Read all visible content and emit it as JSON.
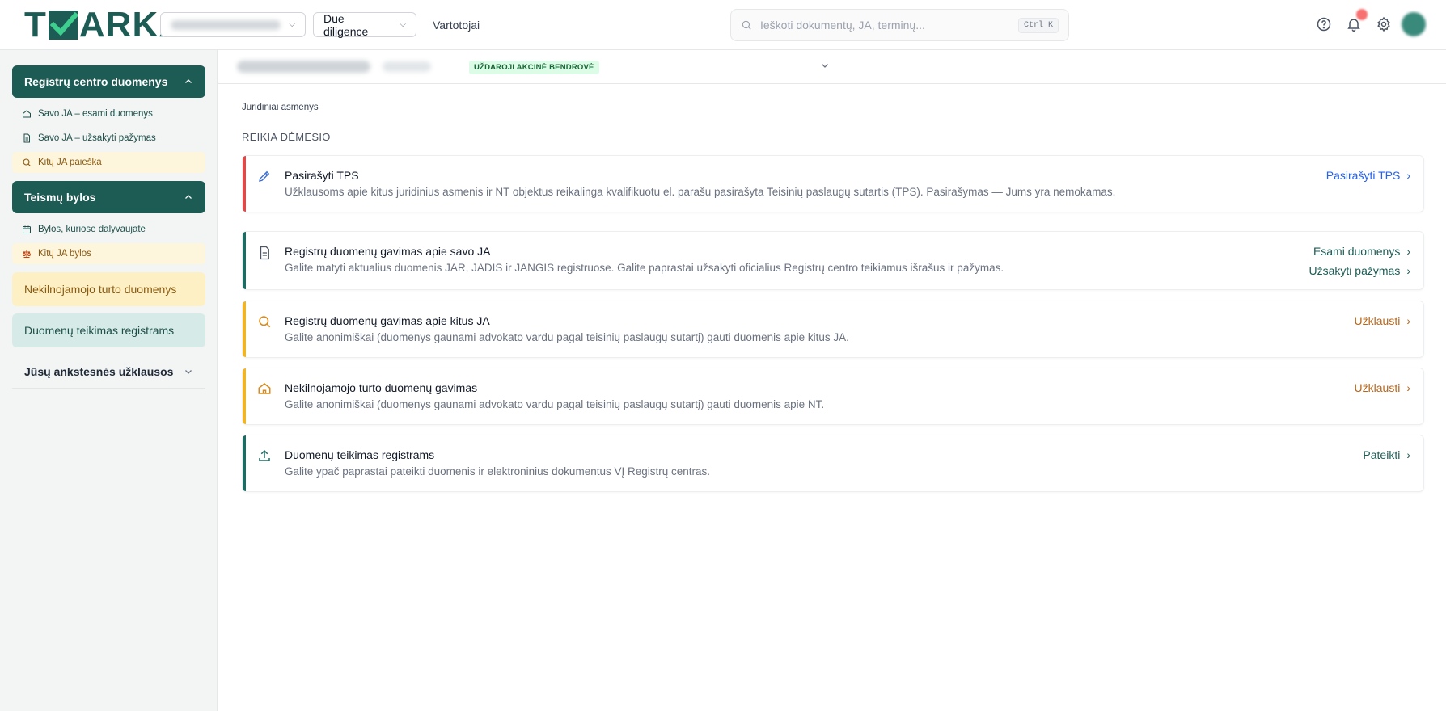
{
  "header": {
    "logo_text_left": "T",
    "logo_text_right": "ARKA",
    "due_diligence_label": "Due diligence",
    "users_link": "Vartotojai",
    "search_placeholder": "Ieškoti dokumentų, JA, terminų...",
    "search_shortcut": "Ctrl K"
  },
  "sidebar": {
    "registry_section": "Registrų centro duomenys",
    "registry_items": [
      "Savo JA – esami duomenys",
      "Savo JA – užsakyti pažymas",
      "Kitų JA paieška"
    ],
    "court_section": "Teismų bylos",
    "court_items": [
      "Bylos, kuriose dalyvaujate",
      "Kitų JA bylos"
    ],
    "real_estate": "Nekilnojamojo turto duomenys",
    "data_submit": "Duomenų teikimas registrams",
    "previous_requests": "Jūsų ankstesnės užklausos"
  },
  "subbar": {
    "company_type_badge": "UŽDAROJI AKCINĖ BENDROVĖ"
  },
  "main": {
    "breadcrumb": "Juridiniai asmenys",
    "section_title": "REIKIA DĖMESIO",
    "cards": [
      {
        "title": "Pasirašyti TPS",
        "desc": "Užklausoms apie kitus juridinius asmenis ir NT objektus reikalinga kvalifikuotu el. parašu pasirašyta Teisinių paslaugų sutartis (TPS). Pasirašymas — Jums yra nemokamas.",
        "actions": [
          "Pasirašyti TPS"
        ],
        "accent": "#dc4a4a",
        "icon": "pencil-icon"
      },
      {
        "title": "Registrų duomenų gavimas apie savo JA",
        "desc": "Galite matyti aktualius duomenis JAR, JADIS ir JANGIS registruose. Galite paprastai užsakyti oficialius Registrų centro teikiamus išrašus ir pažymas.",
        "actions": [
          "Esami duomenys",
          "Užsakyti pažymas"
        ],
        "accent": "#1d6b63",
        "icon": "document-icon"
      },
      {
        "title": "Registrų duomenų gavimas apie kitus JA",
        "desc": "Galite anonimiškai (duomenys gaunami advokato vardu pagal teisinių paslaugų sutartį) gauti duomenis apie kitus JA.",
        "actions": [
          "Užklausti"
        ],
        "accent": "#f0b429",
        "icon": "search-icon"
      },
      {
        "title": "Nekilnojamojo turto duomenų gavimas",
        "desc": "Galite anonimiškai (duomenys gaunami advokato vardu pagal teisinių paslaugų sutartį) gauti duomenis apie NT.",
        "actions": [
          "Užklausti"
        ],
        "accent": "#f0b429",
        "icon": "home-icon"
      },
      {
        "title": "Duomenų teikimas registrams",
        "desc": "Galite ypač paprastai pateikti duomenis ir elektroninius dokumentus VĮ Registrų centras.",
        "actions": [
          "Pateikti"
        ],
        "accent": "#1d6b63",
        "icon": "upload-icon"
      }
    ]
  },
  "colors": {
    "brand": "#1d5b55",
    "link_blue": "#2563eb",
    "link_teal": "#1d5b55",
    "link_orange": "#b7651a"
  }
}
